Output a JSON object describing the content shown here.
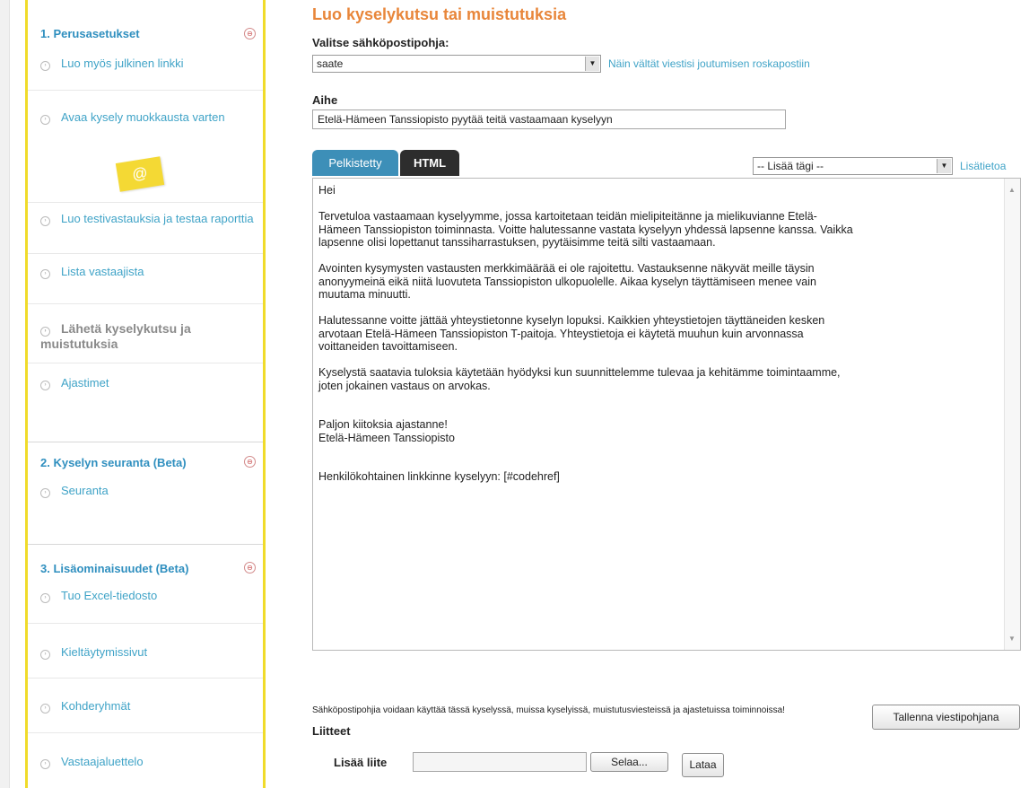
{
  "sidebar": {
    "section1": {
      "title": "1. Perusasetukset",
      "toggle": "⊖"
    },
    "items1": [
      "Luo myös julkinen linkki",
      "Avaa kysely muokkausta varten",
      "Luo testivastauksia ja testaa raporttia",
      "Lista vastaajista",
      "Lähetä kyselykutsu ja muistutuksia",
      "Ajastimet"
    ],
    "sticky": "@",
    "section2": {
      "title": "2. Kyselyn seuranta (Beta)",
      "toggle": "⊖"
    },
    "items2": [
      "Seuranta"
    ],
    "section3": {
      "title": "3. Lisäominaisuudet (Beta)",
      "toggle": "⊖"
    },
    "items3": [
      "Tuo Excel-tiedosto",
      "Kieltäytymissivut",
      "Kohderyhmät",
      "Vastaajaluettelo"
    ]
  },
  "main": {
    "title": "Luo kyselykutsu tai muistutuksia",
    "template_label": "Valitse sähköpostipohja:",
    "template_value": "saate",
    "spam_link": "Näin vältät viestisi joutumisen roskapostiin",
    "subject_label": "Aihe",
    "subject_value": "Etelä-Hämeen Tanssiopisto pyytää teitä vastaamaan kyselyyn",
    "tabs": [
      "Pelkistetty",
      "HTML"
    ],
    "tag_select": "-- Lisää tägi --",
    "more_info_link": "Lisätietoa",
    "body": "Hei\n\nTervetuloa vastaamaan kyselyymme, jossa kartoitetaan teidän mielipiteitänne ja mielikuvianne Etelä-\nHämeen Tanssiopiston toiminnasta. Voitte halutessanne vastata kyselyyn yhdessä lapsenne kanssa. Vaikka\nlapsenne olisi lopettanut tanssiharrastuksen, pyytäisimme teitä silti vastaamaan.\n\nAvointen kysymysten vastausten merkkimäärää ei ole rajoitettu. Vastauksenne näkyvät meille täysin\nanonyymeinä eikä niitä luovuteta Tanssiopiston ulkopuolelle. Aikaa kyselyn täyttämiseen menee vain\nmuutama minuutti.\n\nHalutessanne voitte jättää yhteystietonne kyselyn lopuksi. Kaikkien yhteystietojen täyttäneiden kesken\narvotaan Etelä-Hämeen Tanssiopiston T-paitoja. Yhteystietoja ei käytetä muuhun kuin arvonnassa\nvoittaneiden tavoittamiseen.\n\nKyselystä saatavia tuloksia käytetään hyödyksi kun suunnittelemme tulevaa ja kehitämme toimintaamme,\njoten jokainen vastaus on arvokas.\n\n\nPaljon kiitoksia ajastanne!\nEtelä-Hämeen Tanssiopisto\n\n\nHenkilökohtainen linkkinne kyselyyn: [#codehref]",
    "note": "Sähköpostipohjia voidaan käyttää tässä kyselyssä, muissa kyselyissä, muistutusviesteissä ja ajastetuissa toiminnoissa!",
    "save_button": "Tallenna viestipohjana",
    "attachments_label": "Liitteet",
    "add_attachment_label": "Lisää liite",
    "browse_button": "Selaa...",
    "upload_button": "Lataa"
  }
}
